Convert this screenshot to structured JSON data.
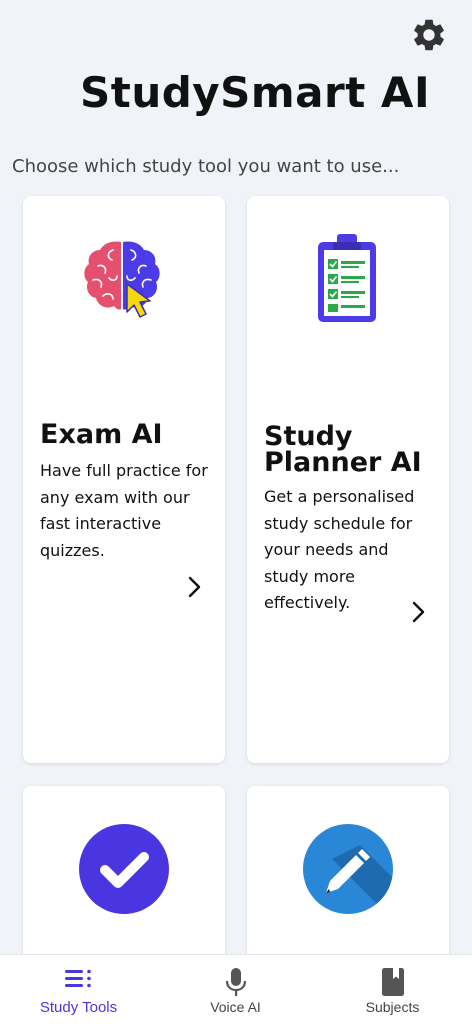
{
  "header": {
    "title": "StudySmart AI",
    "settings_icon": "gear-icon"
  },
  "subtitle": "Choose which study tool you want to use...",
  "cards": [
    {
      "icon": "brain-cursor-icon",
      "title": "Exam AI",
      "description": "Have full practice for any exam with our fast interactive quizzes."
    },
    {
      "icon": "clipboard-checklist-icon",
      "title": "Study Planner AI",
      "description": "Get a personalised study schedule for your needs and study more effectively."
    },
    {
      "icon": "checkmark-circle-icon"
    },
    {
      "icon": "pencil-circle-icon"
    }
  ],
  "bottom_nav": [
    {
      "label": "Study Tools",
      "icon": "list-icon",
      "active": true
    },
    {
      "label": "Voice AI",
      "icon": "microphone-icon",
      "active": false
    },
    {
      "label": "Subjects",
      "icon": "book-icon",
      "active": false
    }
  ],
  "colors": {
    "accent": "#4a36e0",
    "background": "#f0f3f8",
    "brain_pink": "#e5506f",
    "brain_purple": "#4b3ce8",
    "cursor_yellow": "#f5d90a",
    "clipboard_green": "#2aa84a",
    "check_circle": "#4a36e0",
    "pencil_circle": "#2a86d6"
  }
}
